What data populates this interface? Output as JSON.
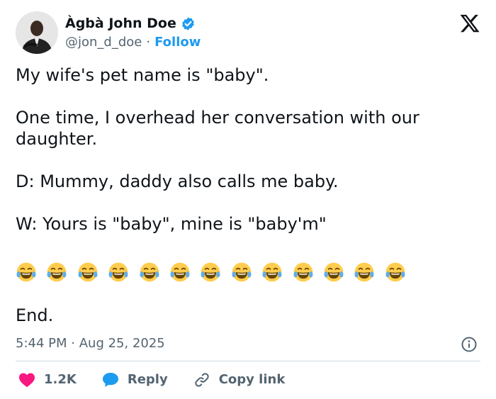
{
  "author": {
    "display_name": "Àgbà John Doe",
    "handle": "@jon_d_doe",
    "separator": "·",
    "follow_label": "Follow"
  },
  "post": {
    "paragraphs": [
      "My wife's pet name is \"baby\".",
      "One time, I overhead her conversation with our daughter.",
      "D: Mummy, daddy also calls me baby.",
      "W: Yours is \"baby\", mine is \"baby'm\""
    ],
    "emoji_count": 13,
    "emoji_icon": "face-with-tears-of-joy-icon",
    "closing": "End."
  },
  "meta": {
    "time": "5:44 PM",
    "separator": "·",
    "date": "Aug 25, 2025"
  },
  "actions": {
    "like_count": "1.2K",
    "reply_label": "Reply",
    "copy_link_label": "Copy link"
  },
  "colors": {
    "accent": "#1d9bf0",
    "like": "#f91880",
    "secondary_text": "#536471",
    "divider": "#cfd9de"
  }
}
